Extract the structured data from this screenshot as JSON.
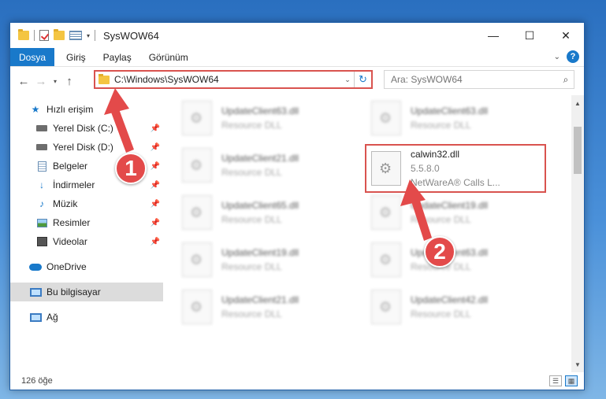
{
  "window": {
    "title": "SysWOW64",
    "controls": {
      "minimize": "—",
      "maximize": "☐",
      "close": "✕"
    }
  },
  "ribbon": {
    "file_tab": "Dosya",
    "tabs": [
      "Giriş",
      "Paylaş",
      "Görünüm"
    ],
    "help": "?"
  },
  "address": {
    "path": "C:\\Windows\\SysWOW64",
    "search_placeholder": "Ara: SysWOW64"
  },
  "sidebar": {
    "quick_access": "Hızlı erişim",
    "items": [
      {
        "label": "Yerel Disk (C:)",
        "icon": "drive-icon"
      },
      {
        "label": "Yerel Disk (D:)",
        "icon": "drive-icon"
      },
      {
        "label": "Belgeler",
        "icon": "documents-icon"
      },
      {
        "label": "İndirmeler",
        "icon": "downloads-icon"
      },
      {
        "label": "Müzik",
        "icon": "music-icon"
      },
      {
        "label": "Resimler",
        "icon": "pictures-icon"
      },
      {
        "label": "Videolar",
        "icon": "videos-icon"
      }
    ],
    "onedrive": "OneDrive",
    "this_pc": "Bu bilgisayar",
    "network": "Ağ"
  },
  "files": {
    "left": [
      {
        "name": "UpdateClient63.dll",
        "type": "Resource DLL"
      },
      {
        "name": "UpdateClient21.dll",
        "type": "Resource DLL"
      },
      {
        "name": "UpdateClient65.dll",
        "type": "Resource DLL"
      },
      {
        "name": "UpdateClient19.dll",
        "type": "Resource DLL"
      },
      {
        "name": "UpdateClient21.dll",
        "type": "Resource DLL"
      }
    ],
    "right": [
      {
        "name": "UpdateClient63.dll",
        "type": "Resource DLL"
      },
      {
        "name": "calwin32.dll",
        "version": "5.5.8.0",
        "type": "NetWareA® Calls L..."
      },
      {
        "name": "UpdateClient19.dll",
        "type": "Resource DLL"
      },
      {
        "name": "UpdateClient63.dll",
        "type": "Resource DLL"
      },
      {
        "name": "UpdateClient42.dll",
        "type": "Resource DLL"
      }
    ]
  },
  "status": {
    "count": "126 öğe"
  },
  "annotations": {
    "step1": "1",
    "step2": "2",
    "color": "#e34a4a"
  }
}
